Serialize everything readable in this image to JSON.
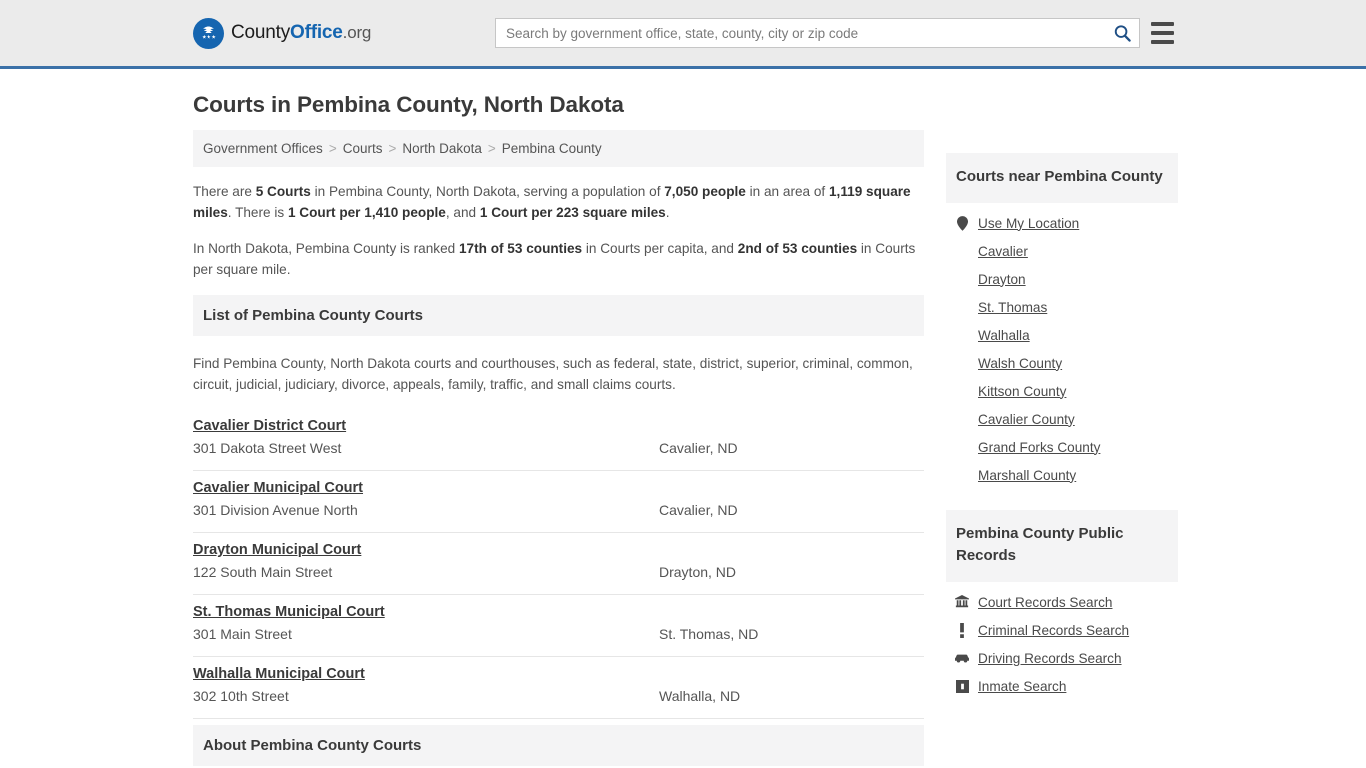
{
  "header": {
    "logo_text_1": "County",
    "logo_text_2": "Office",
    "logo_text_3": ".org",
    "search_placeholder": "Search by government office, state, county, city or zip code",
    "search_value": ""
  },
  "page_title": "Courts in Pembina County, North Dakota",
  "breadcrumb": {
    "items": [
      {
        "label": "Government Offices"
      },
      {
        "label": "Courts"
      },
      {
        "label": "North Dakota"
      },
      {
        "label": "Pembina County"
      }
    ],
    "separator": ">"
  },
  "stats": {
    "p1": [
      {
        "t": "There are ",
        "b": false
      },
      {
        "t": "5 Courts",
        "b": true
      },
      {
        "t": " in Pembina County, North Dakota, serving a population of ",
        "b": false
      },
      {
        "t": "7,050 people",
        "b": true
      },
      {
        "t": " in an area of ",
        "b": false
      },
      {
        "t": "1,119 square miles",
        "b": true
      },
      {
        "t": ". There is ",
        "b": false
      },
      {
        "t": "1 Court per 1,410 people",
        "b": true
      },
      {
        "t": ", and ",
        "b": false
      },
      {
        "t": "1 Court per 223 square miles",
        "b": true
      },
      {
        "t": ".",
        "b": false
      }
    ],
    "p2": [
      {
        "t": "In North Dakota, Pembina County is ranked ",
        "b": false
      },
      {
        "t": "17th of 53 counties",
        "b": true
      },
      {
        "t": " in Courts per capita, and ",
        "b": false
      },
      {
        "t": "2nd of 53 counties",
        "b": true
      },
      {
        "t": " in Courts per square mile.",
        "b": false
      }
    ]
  },
  "list_section": {
    "heading": "List of Pembina County Courts",
    "description": "Find Pembina County, North Dakota courts and courthouses, such as federal, state, district, superior, criminal, common, circuit, judicial, judiciary, divorce, appeals, family, traffic, and small claims courts.",
    "courts": [
      {
        "name": "Cavalier District Court",
        "address": "301 Dakota Street West",
        "city": "Cavalier, ND"
      },
      {
        "name": "Cavalier Municipal Court",
        "address": "301 Division Avenue North",
        "city": "Cavalier, ND"
      },
      {
        "name": "Drayton Municipal Court",
        "address": "122 South Main Street",
        "city": "Drayton, ND"
      },
      {
        "name": "St. Thomas Municipal Court",
        "address": "301 Main Street",
        "city": "St. Thomas, ND"
      },
      {
        "name": "Walhalla Municipal Court",
        "address": "302 10th Street",
        "city": "Walhalla, ND"
      }
    ]
  },
  "about_section": {
    "heading": "About Pembina County Courts"
  },
  "sidebar": {
    "nearby": {
      "heading": "Courts near Pembina County",
      "items": [
        {
          "label": "Use My Location",
          "icon": "map-pin-icon"
        },
        {
          "label": "Cavalier",
          "icon": ""
        },
        {
          "label": "Drayton",
          "icon": ""
        },
        {
          "label": "St. Thomas",
          "icon": ""
        },
        {
          "label": "Walhalla",
          "icon": ""
        },
        {
          "label": "Walsh County",
          "icon": ""
        },
        {
          "label": "Kittson County",
          "icon": ""
        },
        {
          "label": "Cavalier County",
          "icon": ""
        },
        {
          "label": "Grand Forks County",
          "icon": ""
        },
        {
          "label": "Marshall County",
          "icon": ""
        }
      ]
    },
    "records": {
      "heading": "Pembina County Public Records",
      "items": [
        {
          "label": "Court Records Search",
          "icon": "courthouse-icon"
        },
        {
          "label": "Criminal Records Search",
          "icon": "exclamation-icon"
        },
        {
          "label": "Driving Records Search",
          "icon": "car-icon"
        },
        {
          "label": "Inmate Search",
          "icon": "jail-icon"
        }
      ]
    }
  },
  "colors": {
    "header_bg": "#ebebeb",
    "header_border": "#3b71a8",
    "panel_bg": "#f4f4f5",
    "brand_blue": "#1565b0",
    "text_dark": "#3a3a3a",
    "text_body": "#555555"
  }
}
